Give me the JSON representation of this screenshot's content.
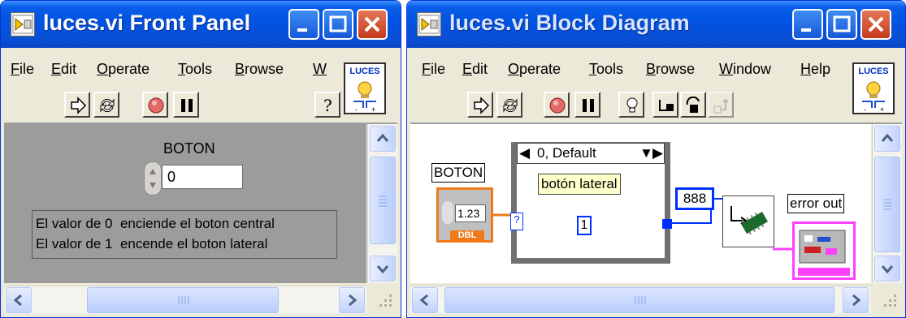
{
  "front_panel": {
    "title": "luces.vi Front Panel",
    "menus": [
      "File",
      "Edit",
      "Operate",
      "Tools",
      "Browse",
      "W"
    ],
    "vi_icon_label": "LUCES",
    "control": {
      "label": "BOTON",
      "value": "0"
    },
    "comment": {
      "line1": "El valor de 0  enciende el boton central",
      "line2": "El valor de 1  encende el boton lateral"
    }
  },
  "block_diagram": {
    "title": "luces.vi Block Diagram",
    "menus": [
      "File",
      "Edit",
      "Operate",
      "Tools",
      "Browse",
      "Window",
      "Help"
    ],
    "vi_icon_label": "LUCES",
    "terminal": {
      "label": "BOTON",
      "value": "1.23",
      "type": "DBL"
    },
    "case_selector": "0, Default",
    "case_label": "botón lateral",
    "case_constant": "1",
    "port_constant": "888",
    "error_out_label": "error out",
    "selector_terminal": "?"
  },
  "colors": {
    "titlebar": "#0054e3",
    "panel_bg": "#9c9c9c",
    "wire_blue": "#0030ff",
    "dbl_orange": "#f07a1a",
    "error_pink": "#ff40ff",
    "label_yellow": "#ffffcc"
  },
  "icons": {
    "run": "run-arrow-icon",
    "run_continuous": "run-continuously-icon",
    "abort": "abort-stop-icon",
    "pause": "pause-icon",
    "highlight": "highlight-execution-bulb-icon",
    "context_help": "context-help-icon"
  }
}
